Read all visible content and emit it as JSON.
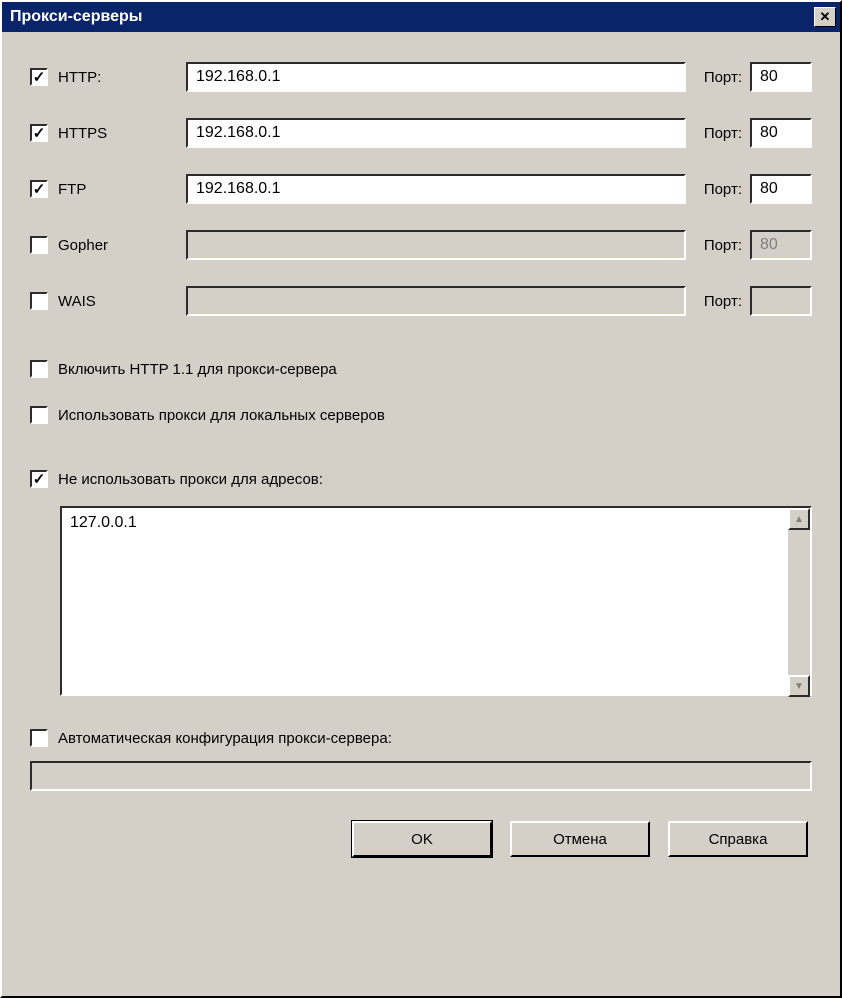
{
  "window": {
    "title": "Прокси-серверы"
  },
  "proxies": [
    {
      "label": "HTTP:",
      "checked": true,
      "address": "192.168.0.1",
      "port": "80",
      "enabled": true
    },
    {
      "label": "HTTPS",
      "checked": true,
      "address": "192.168.0.1",
      "port": "80",
      "enabled": true
    },
    {
      "label": "FTP",
      "checked": true,
      "address": "192.168.0.1",
      "port": "80",
      "enabled": true
    },
    {
      "label": "Gopher",
      "checked": false,
      "address": "",
      "port": "80",
      "enabled": false
    },
    {
      "label": "WAIS",
      "checked": false,
      "address": "",
      "port": "",
      "enabled": false
    }
  ],
  "port_label": "Порт:",
  "options": {
    "http11": {
      "checked": false,
      "label": "Включить HTTP 1.1 для прокси-сервера"
    },
    "local": {
      "checked": false,
      "label": "Использовать прокси для локальных серверов"
    },
    "bypass": {
      "checked": true,
      "label": "Не использовать прокси для адресов:"
    },
    "auto": {
      "checked": false,
      "label": "Автоматическая конфигурация прокси-сервера:"
    }
  },
  "bypass_list": "127.0.0.1",
  "autoconfig_url": "",
  "buttons": {
    "ok": "OK",
    "cancel": "Отмена",
    "help": "Справка"
  }
}
